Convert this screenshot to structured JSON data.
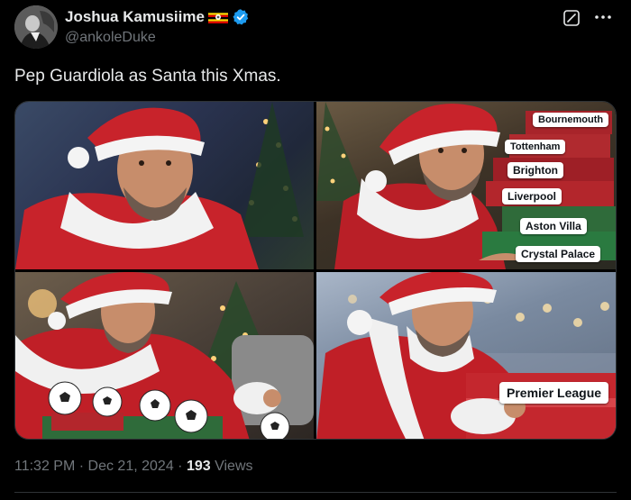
{
  "author": {
    "display_name": "Joshua Kamusiime",
    "handle": "@ankoleDuke",
    "verified": true,
    "flag_icon": "uganda-flag-icon",
    "verified_icon": "verified-badge-icon",
    "verified_color": "#1d9bf0"
  },
  "header_icons": {
    "grok": "grok-icon",
    "more": "more-icon"
  },
  "tweet": {
    "text": "Pep Guardiola as Santa this Xmas."
  },
  "media": {
    "photo2_tags": [
      "Bournemouth",
      "Tottenham",
      "Brighton",
      "Liverpool",
      "Aston Villa",
      "Crystal Palace"
    ],
    "photo4_tag": "Premier League"
  },
  "meta": {
    "time": "11:32 PM",
    "separator": "·",
    "date": "Dec 21, 2024",
    "views_count": "193",
    "views_label": "Views"
  },
  "colors": {
    "background": "#000000",
    "primary_text": "#e7e9ea",
    "secondary_text": "#71767b",
    "divider": "#2f3336",
    "santa_red": "#c8232b"
  }
}
